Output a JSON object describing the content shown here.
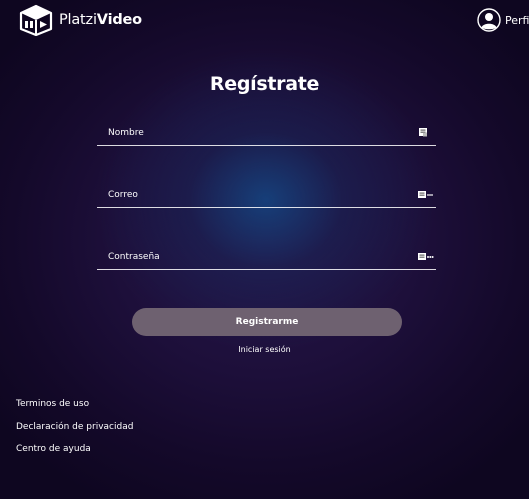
{
  "header": {
    "logo_text_light": "Platzi",
    "logo_text_bold": "Video",
    "profile_label": "Perfil"
  },
  "form": {
    "title": "Regístrate",
    "fields": [
      {
        "placeholder": "Nombre",
        "value": "",
        "icon": "name-card-icon"
      },
      {
        "placeholder": "Correo",
        "value": "",
        "icon": "email-icon"
      },
      {
        "placeholder": "Contraseña",
        "value": "",
        "icon": "password-key-icon"
      }
    ],
    "submit_label": "Registrarme",
    "login_link": "Iniciar sesión"
  },
  "footer": {
    "links": [
      "Terminos de uso",
      "Declaración de privacidad",
      "Centro de ayuda"
    ]
  },
  "colors": {
    "background": "#1d0f3a",
    "button": "#6e6170",
    "text": "#ffffff"
  }
}
